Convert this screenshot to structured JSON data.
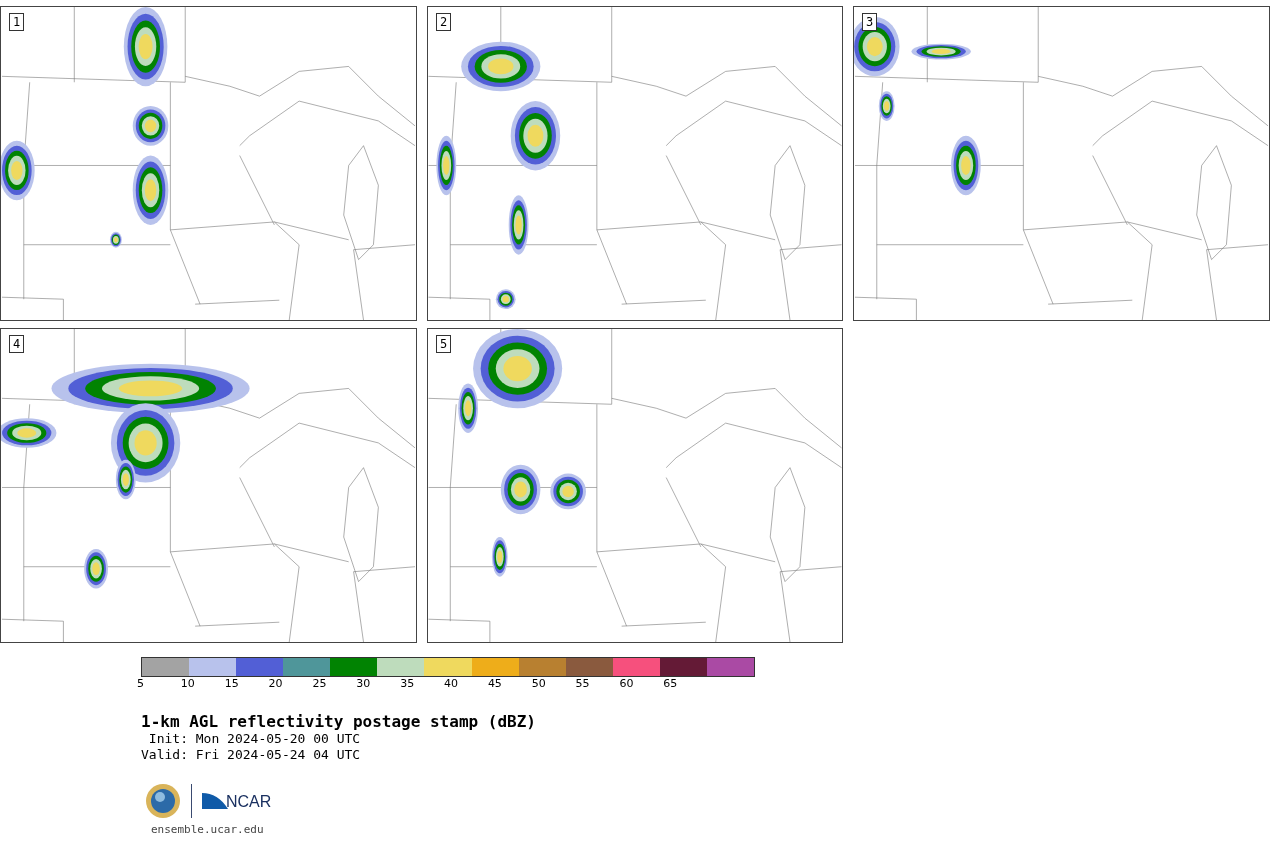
{
  "panels": [
    {
      "label": "1"
    },
    {
      "label": "2"
    },
    {
      "label": "3"
    },
    {
      "label": "4"
    },
    {
      "label": "5"
    }
  ],
  "colorbar": {
    "segments": [
      {
        "color": "#a3a3a3"
      },
      {
        "color": "#b8c2ec"
      },
      {
        "color": "#525fd6"
      },
      {
        "color": "#4f969a"
      },
      {
        "color": "#018302"
      },
      {
        "color": "#bedcbc"
      },
      {
        "color": "#efd95e"
      },
      {
        "color": "#eead1a"
      },
      {
        "color": "#b88030"
      },
      {
        "color": "#8a5a3e"
      },
      {
        "color": "#f6507d"
      },
      {
        "color": "#641a36"
      },
      {
        "color": "#aa4aa4"
      }
    ],
    "ticks": [
      "5",
      "10",
      "15",
      "20",
      "25",
      "30",
      "35",
      "40",
      "45",
      "50",
      "55",
      "60",
      "65"
    ]
  },
  "title": "1-km AGL reflectivity postage stamp (dBZ)",
  "init": " Init: Mon 2024-05-20 00 UTC",
  "valid": "Valid: Fri 2024-05-24 04 UTC",
  "logo_text": "NCAR",
  "footer": "ensemble.ucar.edu"
}
